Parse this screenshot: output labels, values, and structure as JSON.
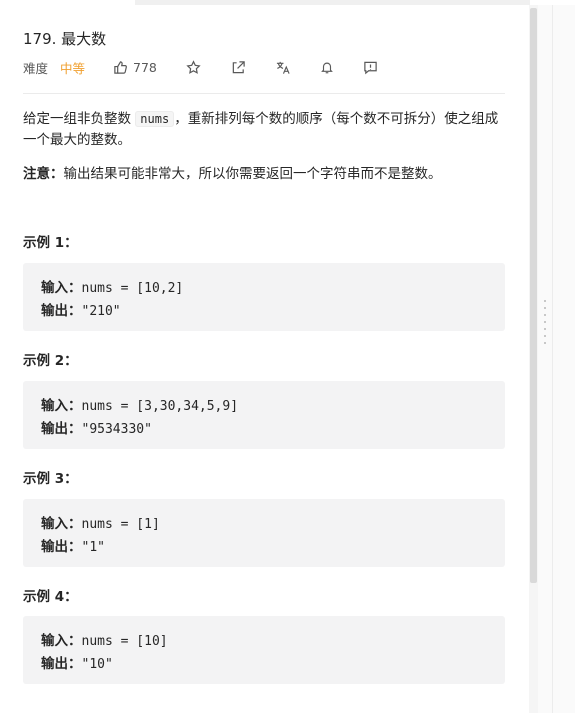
{
  "problem": {
    "title": "179. 最大数",
    "difficulty_label": "难度",
    "difficulty": "中等",
    "likes": "778"
  },
  "icons": {
    "like": "thumbs-up-icon",
    "star": "star-icon",
    "share": "share-icon",
    "translate": "translate-icon",
    "bell": "bell-icon",
    "feedback": "feedback-icon"
  },
  "description": {
    "part1": "给定一组非负整数 ",
    "code": "nums",
    "part2": "，重新排列每个数的顺序（每个数不可拆分）使之组成一个最大的整数。"
  },
  "note": {
    "label": "注意：",
    "text": "输出结果可能非常大，所以你需要返回一个字符串而不是整数。"
  },
  "examples": [
    {
      "title": "示例 1：",
      "input_label": "输入：",
      "input": "nums = [10,2]",
      "output_label": "输出：",
      "output": "\"210\""
    },
    {
      "title": "示例 2：",
      "input_label": "输入：",
      "input": "nums = [3,30,34,5,9]",
      "output_label": "输出：",
      "output": "\"9534330\""
    },
    {
      "title": "示例 3：",
      "input_label": "输入：",
      "input": "nums = [1]",
      "output_label": "输出：",
      "output": "\"1\""
    },
    {
      "title": "示例 4：",
      "input_label": "输入：",
      "input": "nums = [10]",
      "output_label": "输出：",
      "output": "\"10\""
    }
  ],
  "colors": {
    "difficulty_medium": "#f0a030",
    "example_bg": "#f3f3f4"
  }
}
